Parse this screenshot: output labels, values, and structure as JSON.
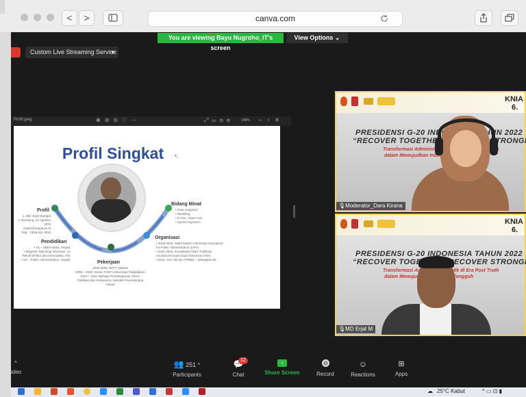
{
  "browser": {
    "url": "canva.com",
    "back_glyph": "<",
    "forward_glyph": ">"
  },
  "zoom": {
    "viewing_banner": "You are viewing Bayu Nugroho_IT's screen",
    "view_options": "View Options ⌄",
    "live_streaming": "Custom Live Streaming Service",
    "live_caret": "▾"
  },
  "slide": {
    "window_name": "Profil.jpeg",
    "zoom_pct": "100%",
    "title": "Profil Singkat",
    "sections": {
      "profil": {
        "label": "Profil",
        "lines": [
          "1. MD. Erjat Munajat",
          "2. Bandung, 23 Agustus 1978",
          "erjatm@unpad.ac.id",
          "Telp. : 0816.611.3333"
        ]
      },
      "pendidikan": {
        "label": "Pendidikan",
        "lines": [
          "• S1 – Matematika, Unpad",
          "• Magister Teknologi Informasi, UI",
          "Teknik Elektro dan Informatika, ITB",
          "• S3 – Public Administration, Unpad"
        ]
      },
      "pekerjaan": {
        "label": "Pekerjaan",
        "lines": [
          "2000-2009, BPPT Jakarta",
          "2009 – 2020, Dosen FISIP Universitas Padjadjaran",
          "2021 – Now, Manajer Pembangunan, Riset,",
          "Publikasi dan Kerjasama, Sekolah Pascasarjana",
          "Unpad"
        ]
      },
      "bidang_minat": {
        "label": "Bidang Minat",
        "lines": [
          "• Data Analytical",
          "• Modeling",
          "• E-Gov., Open Gov",
          "• System Dynamic"
        ]
      },
      "organisasi": {
        "label": "Organisasi",
        "lines": [
          "• 2018-2023, Wakil Sekjen Indonesia Association",
          "  for Public Administration (IAPA)",
          "• 2020-2023, Koordinator Dept. Publikasi",
          "  Asosiasi Ilmuwan Data Indonesia (AIDI)",
          "• 2021, Tim Ahli SE-APNBN – Setwapres RI"
        ]
      }
    }
  },
  "tiles": [
    {
      "corner": "KNIA",
      "corner_sub": "6.",
      "line1": "PRESIDENSI G-20 INDONESIA TAHUN 2022",
      "line2": "“RECOVER TOGETHER, RECOVER STRONGER”",
      "line3": "Transformasi Administrasi Publik di Era Post Truth",
      "line4": "dalam Mewujudkan Indonesia Tangguh",
      "name": "Moderator_Dara Kirana"
    },
    {
      "corner": "KNIA",
      "corner_sub": "6.",
      "line1": "PRESIDENSI G-20 INDONESIA TAHUN 2022",
      "line2": "“RECOVER TOGETHER, RECOVER STRONGER”",
      "line3": "Transformasi Administrasi Publik di Era Post Truth",
      "line4": "dalam Mewujudkan Indonesia Tangguh",
      "name": "MD Erjat M"
    }
  ],
  "toolbar": {
    "video_label": "ideo",
    "participants_label": "Participants",
    "participants_count": "251",
    "chat_label": "Chat",
    "chat_badge": "12",
    "share_label": "Share Screen",
    "record_label": "Record",
    "reactions_label": "Reactions",
    "apps_label": "Apps",
    "caret": "^"
  },
  "taskbar": {
    "weather": "25°C  Kabut",
    "tray": "^  ▭  ⊡  ▮"
  },
  "colors": {
    "share_green": "#27b940",
    "tile_border": "#f0d54b",
    "slide_title": "#2d4e9a",
    "chat_badge": "#e0343a"
  }
}
